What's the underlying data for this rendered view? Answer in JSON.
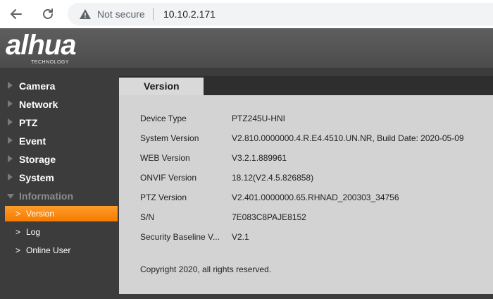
{
  "browser": {
    "not_secure": "Not secure",
    "url": "10.10.2.171",
    "icons": [
      "back-arrow-icon",
      "reload-icon",
      "warning-icon"
    ]
  },
  "logo": {
    "brand": "alhua",
    "tagline": "TECHNOLOGY"
  },
  "sidebar": {
    "items": [
      {
        "label": "Camera"
      },
      {
        "label": "Network"
      },
      {
        "label": "PTZ"
      },
      {
        "label": "Event"
      },
      {
        "label": "Storage"
      },
      {
        "label": "System"
      },
      {
        "label": "Information"
      }
    ],
    "sub_items": [
      {
        "label": "Version"
      },
      {
        "label": "Log"
      },
      {
        "label": "Online User"
      }
    ],
    "sub_arrow": ">"
  },
  "tab": {
    "label": "Version"
  },
  "version_info": [
    {
      "label": "Device Type",
      "value": "PTZ245U-HNI"
    },
    {
      "label": "System Version",
      "value": "V2.810.0000000.4.R.E4.4510.UN.NR, Build Date: 2020-05-09"
    },
    {
      "label": "WEB Version",
      "value": "V3.2.1.889961"
    },
    {
      "label": "ONVIF Version",
      "value": "18.12(V2.4.5.826858)"
    },
    {
      "label": "PTZ Version",
      "value": "V2.401.0000000.65.RHNAD_200303_34756"
    },
    {
      "label": "S/N",
      "value": "7E083C8PAJE8152"
    },
    {
      "label": "Security Baseline V...",
      "value": "V2.1"
    }
  ],
  "copyright": "Copyright 2020, all rights reserved.",
  "colors": {
    "active_item": "#f57b00",
    "sidebar_bg": "#3c3c3c",
    "panel_bg": "#d3d3d3"
  }
}
